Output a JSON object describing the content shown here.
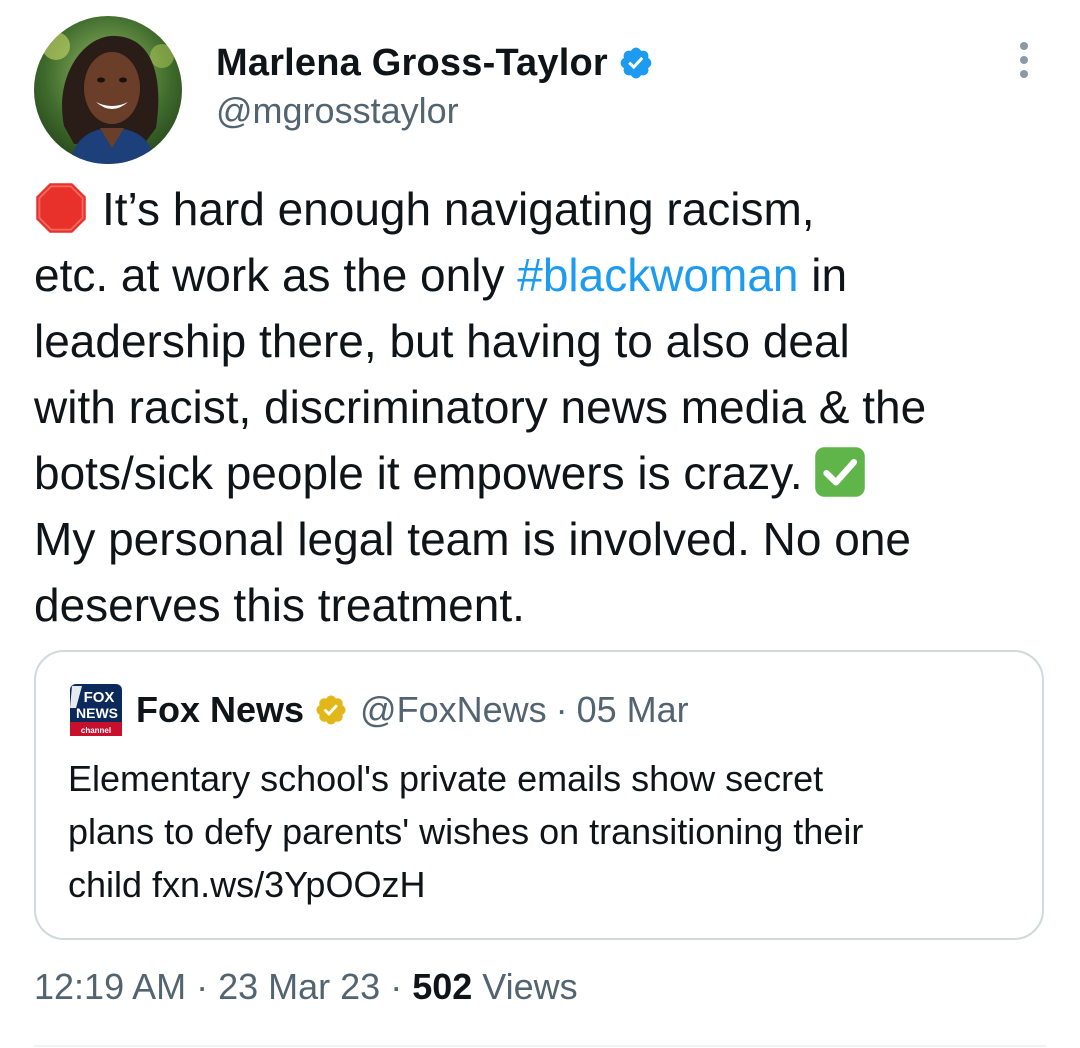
{
  "author": {
    "display_name": "Marlena Gross-Taylor",
    "handle": "@mgrosstaylor",
    "verified": true,
    "avatar_icon": "profile-photo"
  },
  "tweet": {
    "lines": [
      {
        "text": "It’s hard enough navigating racism,",
        "emoji_before": "stop-sign-icon"
      },
      {
        "before": "etc. at work as the only ",
        "hashtag": "#blackwoman",
        "after": " in"
      },
      {
        "text": "leadership there, but having to also deal"
      },
      {
        "text": "with racist, discriminatory news media & the"
      },
      {
        "text": "bots/sick people it empowers is crazy.",
        "emoji_after": "check-mark-icon"
      },
      {
        "text": "My personal legal team is involved.  No one"
      },
      {
        "text": "deserves this treatment."
      }
    ]
  },
  "quote": {
    "logo": "fox-news-logo",
    "name": "Fox News",
    "verified_color": "#e2b719",
    "handle": "@FoxNews",
    "separator": "·",
    "date": "05 Mar",
    "body_lines": [
      "Elementary school's private emails show secret",
      "plans to defy parents' wishes on transitioning their",
      "child fxn.ws/3YpOOzH"
    ]
  },
  "meta": {
    "time": "12:19 AM",
    "separator": "·",
    "date": "23 Mar 23",
    "views_count": "502",
    "views_label": " Views"
  },
  "colors": {
    "link": "#1d9bf0",
    "secondary_text": "#536471",
    "primary_text": "#0f1419",
    "verified_blue": "#1d9bf0",
    "verified_gold": "#e2b719",
    "border": "#cfd9de"
  }
}
